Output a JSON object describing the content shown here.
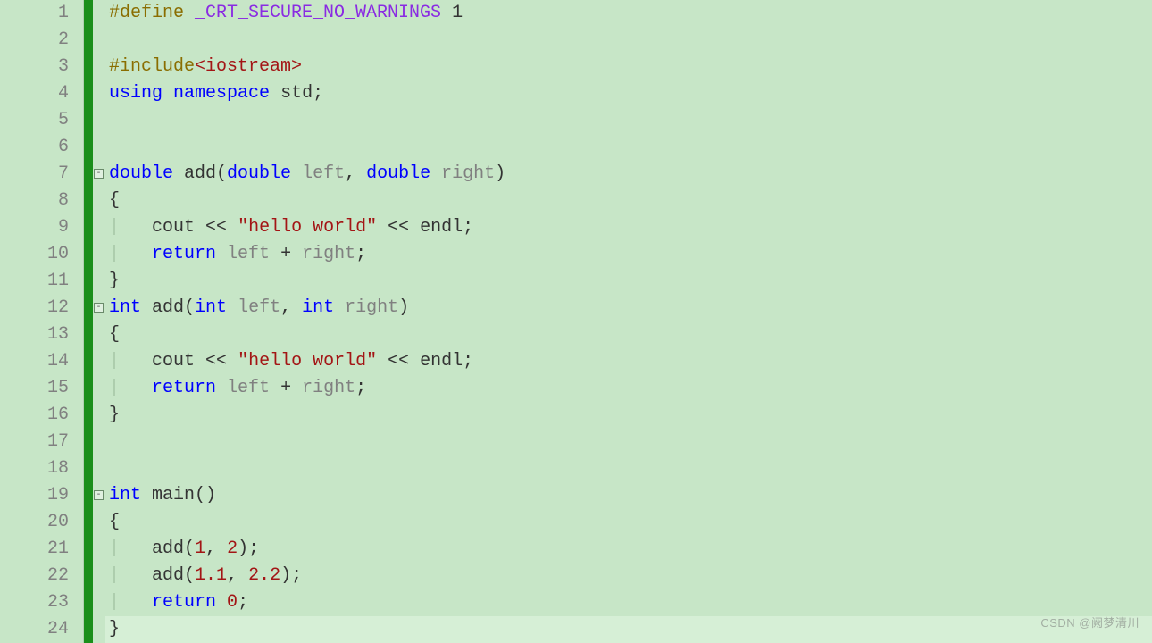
{
  "line_count": 24,
  "fold_markers": [
    {
      "line": 7,
      "symbol": "⊟"
    },
    {
      "line": 12,
      "symbol": "⊟"
    },
    {
      "line": 19,
      "symbol": "⊟"
    }
  ],
  "current_line": 24,
  "code_lines": [
    {
      "n": 1,
      "tokens": [
        [
          "#define ",
          "kw-preproc"
        ],
        [
          "_CRT_SECURE_NO_WARNINGS",
          "kw-macro"
        ],
        [
          " 1",
          "kw-default"
        ]
      ]
    },
    {
      "n": 2,
      "tokens": []
    },
    {
      "n": 3,
      "tokens": [
        [
          "#include",
          "kw-preproc"
        ],
        [
          "<iostream>",
          "kw-header"
        ]
      ]
    },
    {
      "n": 4,
      "tokens": [
        [
          "using",
          "kw-keyword"
        ],
        [
          " ",
          "kw-default"
        ],
        [
          "namespace",
          "kw-keyword"
        ],
        [
          " std;",
          "kw-default"
        ]
      ]
    },
    {
      "n": 5,
      "tokens": []
    },
    {
      "n": 6,
      "tokens": []
    },
    {
      "n": 7,
      "tokens": [
        [
          "double",
          "kw-keyword"
        ],
        [
          " add(",
          "kw-default"
        ],
        [
          "double",
          "kw-keyword"
        ],
        [
          " ",
          "kw-default"
        ],
        [
          "left",
          "kw-param"
        ],
        [
          ", ",
          "kw-default"
        ],
        [
          "double",
          "kw-keyword"
        ],
        [
          " ",
          "kw-default"
        ],
        [
          "right",
          "kw-param"
        ],
        [
          ")",
          "kw-default"
        ]
      ]
    },
    {
      "n": 8,
      "tokens": [
        [
          "{",
          "kw-default"
        ]
      ]
    },
    {
      "n": 9,
      "tokens": [
        [
          "|   ",
          "guide"
        ],
        [
          "cout ",
          "kw-default"
        ],
        [
          "<<",
          "kw-op"
        ],
        [
          " ",
          "kw-default"
        ],
        [
          "\"hello world\"",
          "kw-string"
        ],
        [
          " ",
          "kw-default"
        ],
        [
          "<<",
          "kw-op"
        ],
        [
          " endl;",
          "kw-default"
        ]
      ]
    },
    {
      "n": 10,
      "tokens": [
        [
          "|   ",
          "guide"
        ],
        [
          "return",
          "kw-keyword"
        ],
        [
          " ",
          "kw-default"
        ],
        [
          "left",
          "kw-param"
        ],
        [
          " + ",
          "kw-default"
        ],
        [
          "right",
          "kw-param"
        ],
        [
          ";",
          "kw-default"
        ]
      ]
    },
    {
      "n": 11,
      "tokens": [
        [
          "}",
          "kw-default"
        ]
      ]
    },
    {
      "n": 12,
      "tokens": [
        [
          "int",
          "kw-keyword"
        ],
        [
          " add(",
          "kw-default"
        ],
        [
          "int",
          "kw-keyword"
        ],
        [
          " ",
          "kw-default"
        ],
        [
          "left",
          "kw-param"
        ],
        [
          ", ",
          "kw-default"
        ],
        [
          "int",
          "kw-keyword"
        ],
        [
          " ",
          "kw-default"
        ],
        [
          "right",
          "kw-param"
        ],
        [
          ")",
          "kw-default"
        ]
      ]
    },
    {
      "n": 13,
      "tokens": [
        [
          "{",
          "kw-default"
        ]
      ]
    },
    {
      "n": 14,
      "tokens": [
        [
          "|   ",
          "guide"
        ],
        [
          "cout ",
          "kw-default"
        ],
        [
          "<<",
          "kw-op"
        ],
        [
          " ",
          "kw-default"
        ],
        [
          "\"hello world\"",
          "kw-string"
        ],
        [
          " ",
          "kw-default"
        ],
        [
          "<<",
          "kw-op"
        ],
        [
          " endl;",
          "kw-default"
        ]
      ]
    },
    {
      "n": 15,
      "tokens": [
        [
          "|   ",
          "guide"
        ],
        [
          "return",
          "kw-keyword"
        ],
        [
          " ",
          "kw-default"
        ],
        [
          "left",
          "kw-param"
        ],
        [
          " + ",
          "kw-default"
        ],
        [
          "right",
          "kw-param"
        ],
        [
          ";",
          "kw-default"
        ]
      ]
    },
    {
      "n": 16,
      "tokens": [
        [
          "}",
          "kw-default"
        ]
      ]
    },
    {
      "n": 17,
      "tokens": []
    },
    {
      "n": 18,
      "tokens": []
    },
    {
      "n": 19,
      "tokens": [
        [
          "int",
          "kw-keyword"
        ],
        [
          " main()",
          "kw-default"
        ]
      ]
    },
    {
      "n": 20,
      "tokens": [
        [
          "{",
          "kw-default"
        ]
      ]
    },
    {
      "n": 21,
      "tokens": [
        [
          "|   ",
          "guide"
        ],
        [
          "add(",
          "kw-default"
        ],
        [
          "1",
          "kw-number"
        ],
        [
          ", ",
          "kw-default"
        ],
        [
          "2",
          "kw-number"
        ],
        [
          ");",
          "kw-default"
        ]
      ]
    },
    {
      "n": 22,
      "tokens": [
        [
          "|   ",
          "guide"
        ],
        [
          "add(",
          "kw-default"
        ],
        [
          "1.1",
          "kw-number"
        ],
        [
          ", ",
          "kw-default"
        ],
        [
          "2.2",
          "kw-number"
        ],
        [
          ");",
          "kw-default"
        ]
      ]
    },
    {
      "n": 23,
      "tokens": [
        [
          "|   ",
          "guide"
        ],
        [
          "return",
          "kw-keyword"
        ],
        [
          " ",
          "kw-default"
        ],
        [
          "0",
          "kw-number"
        ],
        [
          ";",
          "kw-default"
        ]
      ]
    },
    {
      "n": 24,
      "tokens": [
        [
          "}",
          "kw-default"
        ]
      ]
    }
  ],
  "watermark": "CSDN @阙梦清川"
}
